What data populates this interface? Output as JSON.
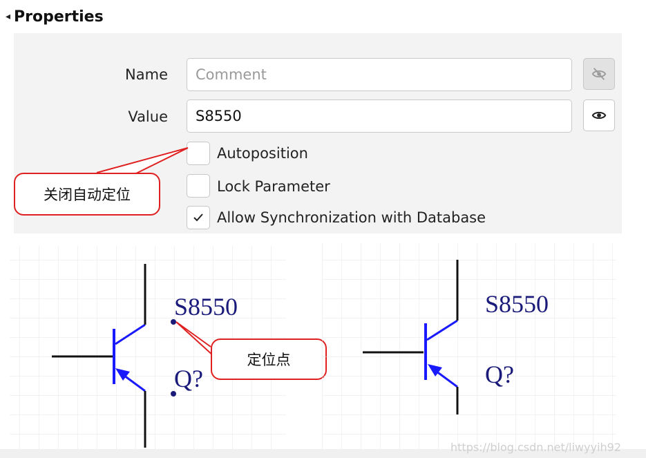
{
  "panel": {
    "title": "Properties"
  },
  "fields": {
    "name_label": "Name",
    "name_placeholder": "Comment",
    "value_label": "Value",
    "value_text": "S8550"
  },
  "icons": {
    "name_visibility": "eye-off-icon",
    "value_visibility": "eye-icon"
  },
  "checkboxes": [
    {
      "label": "Autoposition",
      "checked": false
    },
    {
      "label": "Lock Parameter",
      "checked": false
    },
    {
      "label": "Allow Synchronization with Database",
      "checked": true
    }
  ],
  "callouts": {
    "autoposition_note": "关闭自动定位",
    "anchor_note": "定位点"
  },
  "schematic_left": {
    "value": "S8550",
    "designator": "Q?"
  },
  "schematic_right": {
    "value": "S8550",
    "designator": "Q?"
  },
  "watermark": "https://blog.csdn.net/liwyyih92",
  "colors": {
    "panel_bg": "#f3f3f3",
    "callout_border": "#e02020",
    "wire_blue": "#1a1aff",
    "text_navy": "#1a1a7a"
  }
}
